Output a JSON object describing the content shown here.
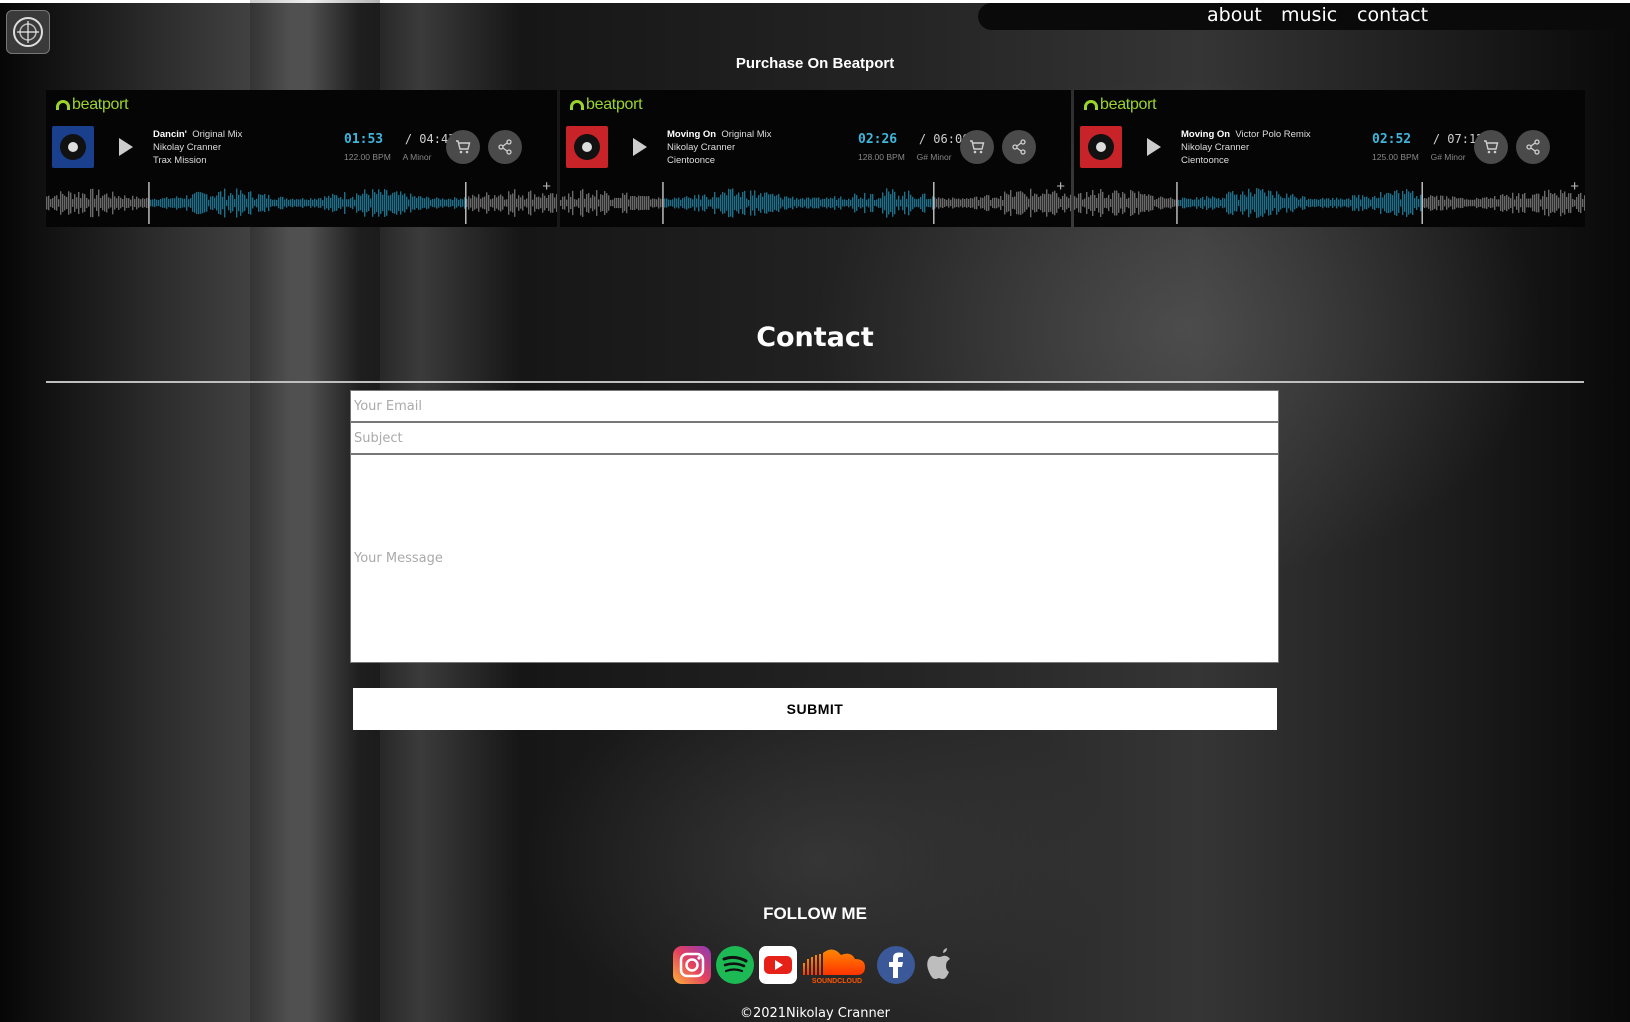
{
  "nav": {
    "about": "about",
    "music": "music",
    "contact": "contact"
  },
  "purchase_heading": "Purchase On Beatport",
  "beatport_brand": "beatport",
  "players": [
    {
      "title": "Dancin'",
      "mix": "Original Mix",
      "artist": "Nikolay Cranner",
      "label": "Trax Mission",
      "current": "01:53",
      "total": "/ 04:43",
      "bpm": "122.00 BPM",
      "key": "A Minor",
      "cover_color": "#1a3f8c",
      "progress": [
        0.4,
        0.82
      ]
    },
    {
      "title": "Moving On",
      "mix": "Original Mix",
      "artist": "Nikolay Cranner",
      "label": "Cientoonce",
      "current": "02:26",
      "total": "/ 06:06",
      "bpm": "128.00 BPM",
      "key": "G# Minor",
      "cover_color": "#c72329",
      "progress": [
        0.4,
        0.73
      ]
    },
    {
      "title": "Moving On",
      "mix": "Victor Polo Remix",
      "artist": "Nikolay Cranner",
      "label": "Cientoonce",
      "current": "02:52",
      "total": "/ 07:12",
      "bpm": "125.00 BPM",
      "key": "G# Minor",
      "cover_color": "#c72329",
      "progress": [
        0.4,
        0.68
      ]
    }
  ],
  "contact": {
    "title": "Contact",
    "email_placeholder": "Your Email",
    "subject_placeholder": "Subject",
    "message_placeholder": "Your Message",
    "submit_label": "SUBMIT"
  },
  "follow": {
    "heading": "FOLLOW ME",
    "icons": [
      "instagram-icon",
      "spotify-icon",
      "youtube-icon",
      "soundcloud-icon",
      "facebook-icon",
      "apple-icon"
    ],
    "soundcloud_text": "SOUNDCLOUD"
  },
  "copyright": "©2021Nikolay Cranner",
  "colors": {
    "beatport_green": "#9bd42b",
    "time_blue": "#3fb6dd",
    "wave_played": "#1f6f8b",
    "wave_unplayed": "#6a6a6a"
  }
}
